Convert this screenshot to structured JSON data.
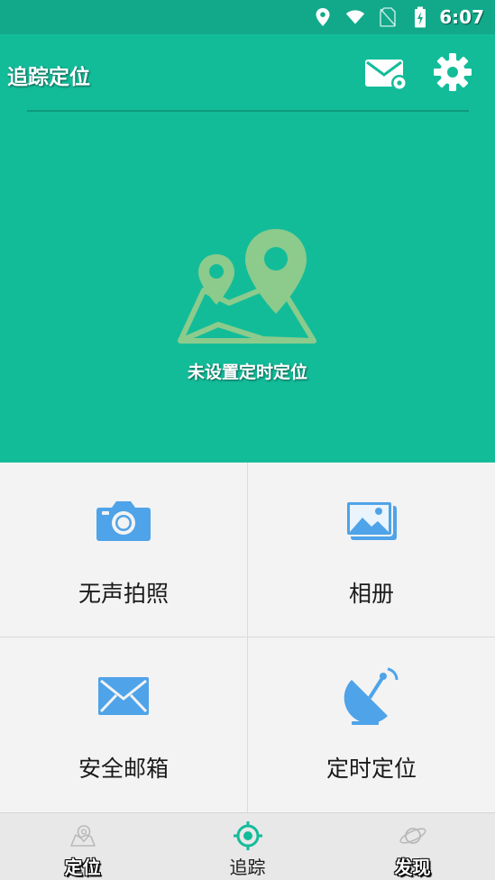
{
  "status_bar": {
    "time": "6:07",
    "background": "#11a98a",
    "icons": [
      "location-pin-icon",
      "wifi-icon",
      "no-sim-icon",
      "battery-charging-icon"
    ]
  },
  "app_bar": {
    "title": "追踪定位",
    "background": "#13bc99",
    "actions": [
      "mail-settings-icon",
      "gear-icon"
    ]
  },
  "hero": {
    "caption": "未设置定时定位",
    "illustration": "map-pins-icon",
    "illustration_color": "#8ccb8c"
  },
  "features": [
    {
      "label": "无声拍照",
      "icon": "camera-icon"
    },
    {
      "label": "相册",
      "icon": "gallery-icon"
    },
    {
      "label": "安全邮箱",
      "icon": "envelope-icon"
    },
    {
      "label": "定时定位",
      "icon": "satellite-dish-icon"
    }
  ],
  "feature_icon_color": "#4fa3e8",
  "bottom_nav": {
    "items": [
      {
        "label": "定位",
        "icon": "map-pin-outline-icon",
        "active": false
      },
      {
        "label": "追踪",
        "icon": "crosshair-icon",
        "active": true
      },
      {
        "label": "发现",
        "icon": "planet-icon",
        "active": false
      }
    ],
    "active_color": "#13bc99"
  }
}
